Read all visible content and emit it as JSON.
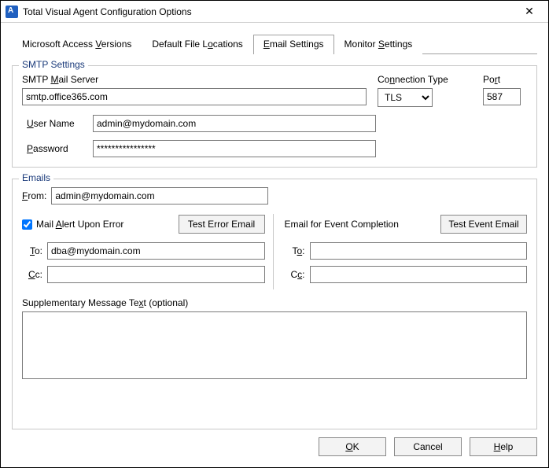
{
  "window": {
    "title": "Total Visual Agent Configuration Options"
  },
  "tabs": {
    "access": {
      "pre": "Microsoft Access ",
      "u": "V",
      "post": "ersions"
    },
    "loc": {
      "pre": "Default File L",
      "u": "o",
      "post": "cations"
    },
    "email": {
      "pre": "",
      "u": "E",
      "post": "mail Settings"
    },
    "monitor": {
      "pre": "Monitor ",
      "u": "S",
      "post": "ettings"
    }
  },
  "smtp": {
    "legend": "SMTP Settings",
    "mail_label": {
      "pre": "SMTP ",
      "u": "M",
      "post": "ail Server"
    },
    "mail_value": "smtp.office365.com",
    "conn_label": {
      "pre": "Co",
      "u": "n",
      "post": "nection Type"
    },
    "conn_value": "TLS",
    "port_label": {
      "pre": "Po",
      "u": "r",
      "post": "t"
    },
    "port_value": "587",
    "user_label": {
      "pre": "",
      "u": "U",
      "post": "ser Name"
    },
    "user_value": "admin@mydomain.com",
    "pass_label": {
      "pre": "",
      "u": "P",
      "post": "assword"
    },
    "pass_value": "****************"
  },
  "emails": {
    "legend": "Emails",
    "from_label": {
      "pre": "",
      "u": "F",
      "post": "rom:"
    },
    "from_value": "admin@mydomain.com",
    "alert_label": {
      "pre": "Mail ",
      "u": "A",
      "post": "lert Upon Error"
    },
    "test_error_btn": "Test Error Email",
    "event_label": "Email for Event Completion",
    "test_event_btn": "Test Event Email",
    "left": {
      "to_label": {
        "pre": "",
        "u": "T",
        "post": "o:"
      },
      "to_value": "dba@mydomain.com",
      "cc_label": {
        "pre": "",
        "u": "C",
        "post": "c:"
      },
      "cc_value": ""
    },
    "right": {
      "to_label": {
        "pre": "T",
        "u": "o",
        "post": ":"
      },
      "to_value": "",
      "cc_label": {
        "pre": "C",
        "u": "c",
        "post": ":"
      },
      "cc_value": ""
    },
    "supp_label": {
      "pre": "Supplementary Message Te",
      "u": "x",
      "post": "t (optional)"
    },
    "supp_value": ""
  },
  "buttons": {
    "ok": {
      "pre": "",
      "u": "O",
      "post": "K"
    },
    "cancel": {
      "pre": "",
      "u": "",
      "post": "Cancel"
    },
    "help": {
      "pre": "",
      "u": "H",
      "post": "elp"
    }
  }
}
